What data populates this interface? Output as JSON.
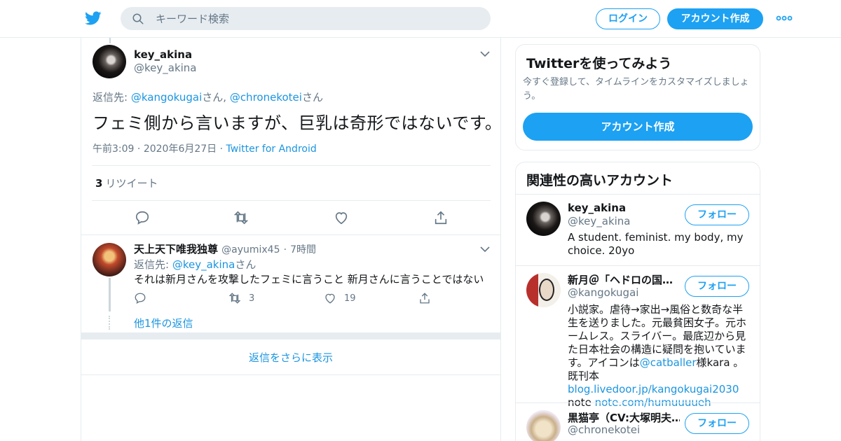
{
  "header": {
    "search_placeholder": "キーワード検索",
    "login_label": "ログイン",
    "signup_label": "アカウント作成",
    "brand_color": "#1da1f2"
  },
  "tweet": {
    "name": "key_akina",
    "handle": "@key_akina",
    "replying_prefix": "返信先: ",
    "replying_user1": "@kangokugai",
    "replying_san1": "さん, ",
    "replying_user2": "@chronekotei",
    "replying_san2": "さん",
    "text": "フェミ側から言いますが、巨乳は奇形ではないです。",
    "time": "午前3:09",
    "date": "2020年6月27日",
    "sep": "·",
    "source": "Twitter for Android",
    "retweet_count": "3",
    "retweet_label": "リツイート"
  },
  "reply": {
    "name": "天上天下唯我独尊",
    "handle": "@ayumix45",
    "sep": "·",
    "age": "7時間",
    "replying_prefix": "返信先: ",
    "replying_user": "@key_akina",
    "replying_san": "さん",
    "text": "それは新月さんを攻撃したフェミに言うこと 新月さんに言うことではない",
    "retweets": "3",
    "likes": "19",
    "more_replies": "他1件の返信"
  },
  "show_more_label": "返信をさらに表示",
  "signup_card": {
    "title": "Twitterを使ってみよう",
    "desc": "今すぐ登録して、タイムラインをカスタマイズしましょう。",
    "button": "アカウント作成"
  },
  "related": {
    "title": "関連性の高いアカウント",
    "follow_label": "フォロー",
    "accounts": [
      {
        "name": "key_akina",
        "handle": "@key_akina",
        "bio": "A student. feminist. my body, my choice. 20yo"
      },
      {
        "name": "新月＠「ヘドロの国…",
        "handle": "@kangokugai",
        "bio_before": "小説家。虐待→家出→風俗と数奇な半生を送りました。元最貧困女子。元ホームレス。スライバー。最底辺から見た日本社会の構造に疑問を抱いています。アイコンは",
        "bio_link1": "@catballer",
        "bio_mid": "様kara 。 既刊本",
        "bio_link2": "blog.livedoor.jp/kangokugai2030",
        "bio_note": " note ",
        "bio_link3": "note.com/humuuuueh"
      },
      {
        "name": "黒猫亭（CV:大塚明夫…",
        "handle": "@chronekotei"
      }
    ]
  }
}
